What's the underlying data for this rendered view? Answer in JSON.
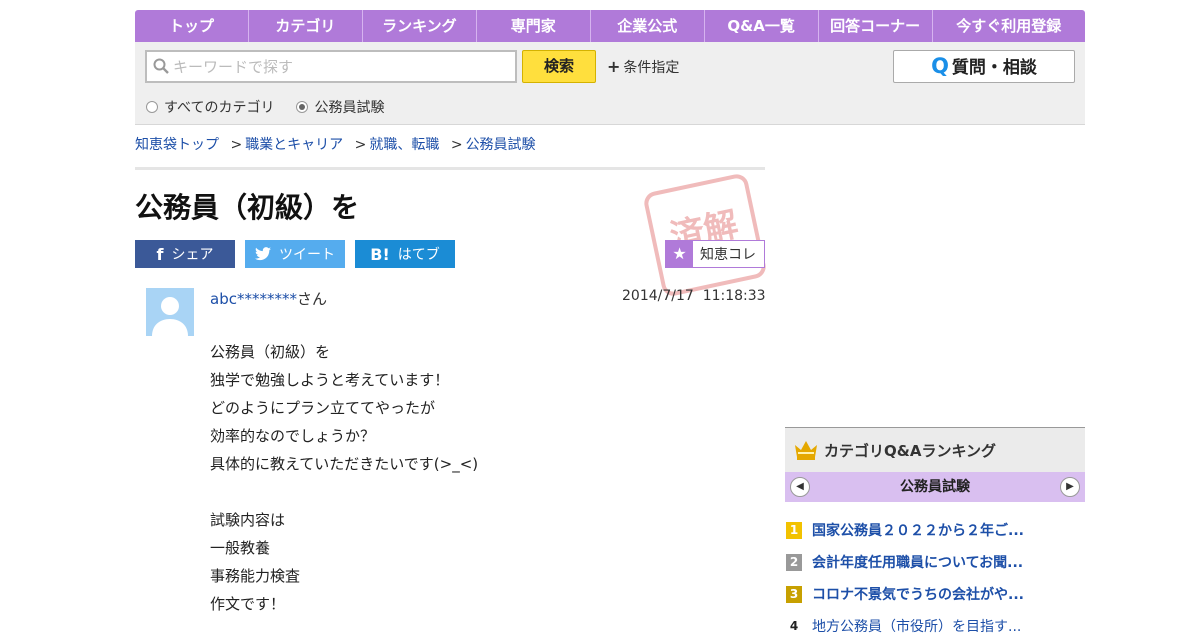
{
  "nav": {
    "items": [
      "トップ",
      "カテゴリ",
      "ランキング",
      "専門家",
      "企業公式",
      "Q&A一覧",
      "回答コーナー",
      "今すぐ利用登録"
    ]
  },
  "search": {
    "placeholder": "キーワードで探す",
    "button_label": "検索",
    "condition_label": "条件指定",
    "ask_button_label": "質問・相談",
    "ask_icon": "Q",
    "radio_all": "すべてのカテゴリ",
    "radio_current": "公務員試験"
  },
  "breadcrumb": [
    "知恵袋トップ",
    "職業とキャリア",
    "就職、転職",
    "公務員試験"
  ],
  "question": {
    "title": "公務員（初級）を",
    "stamp_text": "済解",
    "user": "abc********",
    "user_suffix": "さん",
    "date": "2014/7/17",
    "time": "11:18:33",
    "body": [
      "公務員（初級）を",
      "独学で勉強しようと考えています！",
      "どのようにプラン立ててやったが",
      "効率的なのでしょうか？",
      "具体的に教えていただきたいです(>_<)",
      "",
      "試験内容は",
      "一般教養",
      "事務能力検査",
      "作文です！"
    ]
  },
  "share": {
    "facebook": "シェア",
    "twitter": "ツイート",
    "hatena": "はてブ",
    "hatena_icon": "B!",
    "chiekore": "知恵コレ"
  },
  "ranking": {
    "title": "カテゴリQ&Aランキング",
    "category": "公務員試験",
    "items": [
      {
        "rank": "1",
        "text": "国家公務員２０２２から２年ご..."
      },
      {
        "rank": "2",
        "text": "会計年度任用職員についてお聞..."
      },
      {
        "rank": "3",
        "text": "コロナ不景気でうちの会社がや..."
      },
      {
        "rank": "4",
        "text": "地方公務員（市役所）を目指す..."
      }
    ]
  }
}
